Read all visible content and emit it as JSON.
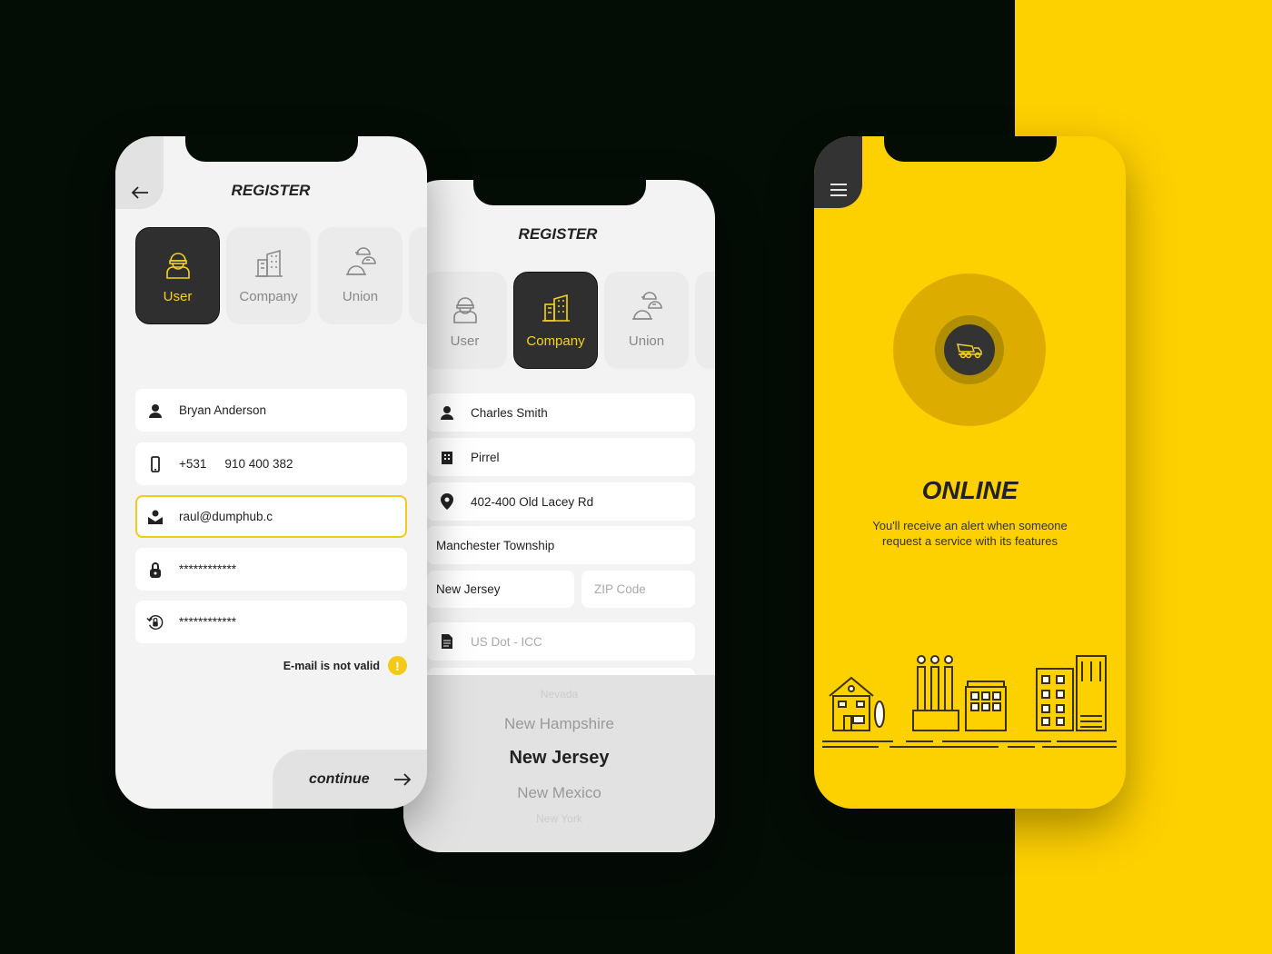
{
  "colors": {
    "accent": "#fdd000",
    "dark": "#2f2f2f",
    "screen": "#f3f3f3"
  },
  "phone_company": {
    "title": "REGISTER",
    "tabs": [
      {
        "label": "User",
        "icon": "worker-icon"
      },
      {
        "label": "Company",
        "icon": "building-icon",
        "active": true
      },
      {
        "label": "Union",
        "icon": "helmets-icon"
      }
    ],
    "fields": {
      "name": "Charles Smith",
      "company": "Pirrel",
      "address": "402-400 Old Lacey Rd",
      "city": "Manchester Township",
      "state": "New Jersey",
      "zip_placeholder": "ZIP Code",
      "usdot_placeholder": "US Dot - ICC"
    },
    "picker": [
      "Nevada",
      "New Hampshire",
      "New Jersey",
      "New Mexico",
      "New York"
    ],
    "picker_selected": "New Jersey"
  },
  "phone_user": {
    "title": "REGISTER",
    "tabs": [
      {
        "label": "User",
        "icon": "worker-icon",
        "active": true
      },
      {
        "label": "Company",
        "icon": "building-icon"
      },
      {
        "label": "Union",
        "icon": "helmets-icon"
      }
    ],
    "fields": {
      "name": "Bryan Anderson",
      "phone_code": "+531",
      "phone_number": "910 400 382",
      "email": "raul@dumphub.c",
      "password": "************",
      "password_confirm": "************"
    },
    "error": "E-mail is not valid",
    "continue_label": "continue"
  },
  "phone_online": {
    "status": "ONLINE",
    "description_line1": "You'll receive an alert when someone",
    "description_line2": "request a service with its features",
    "icon": "dump-truck-icon"
  }
}
